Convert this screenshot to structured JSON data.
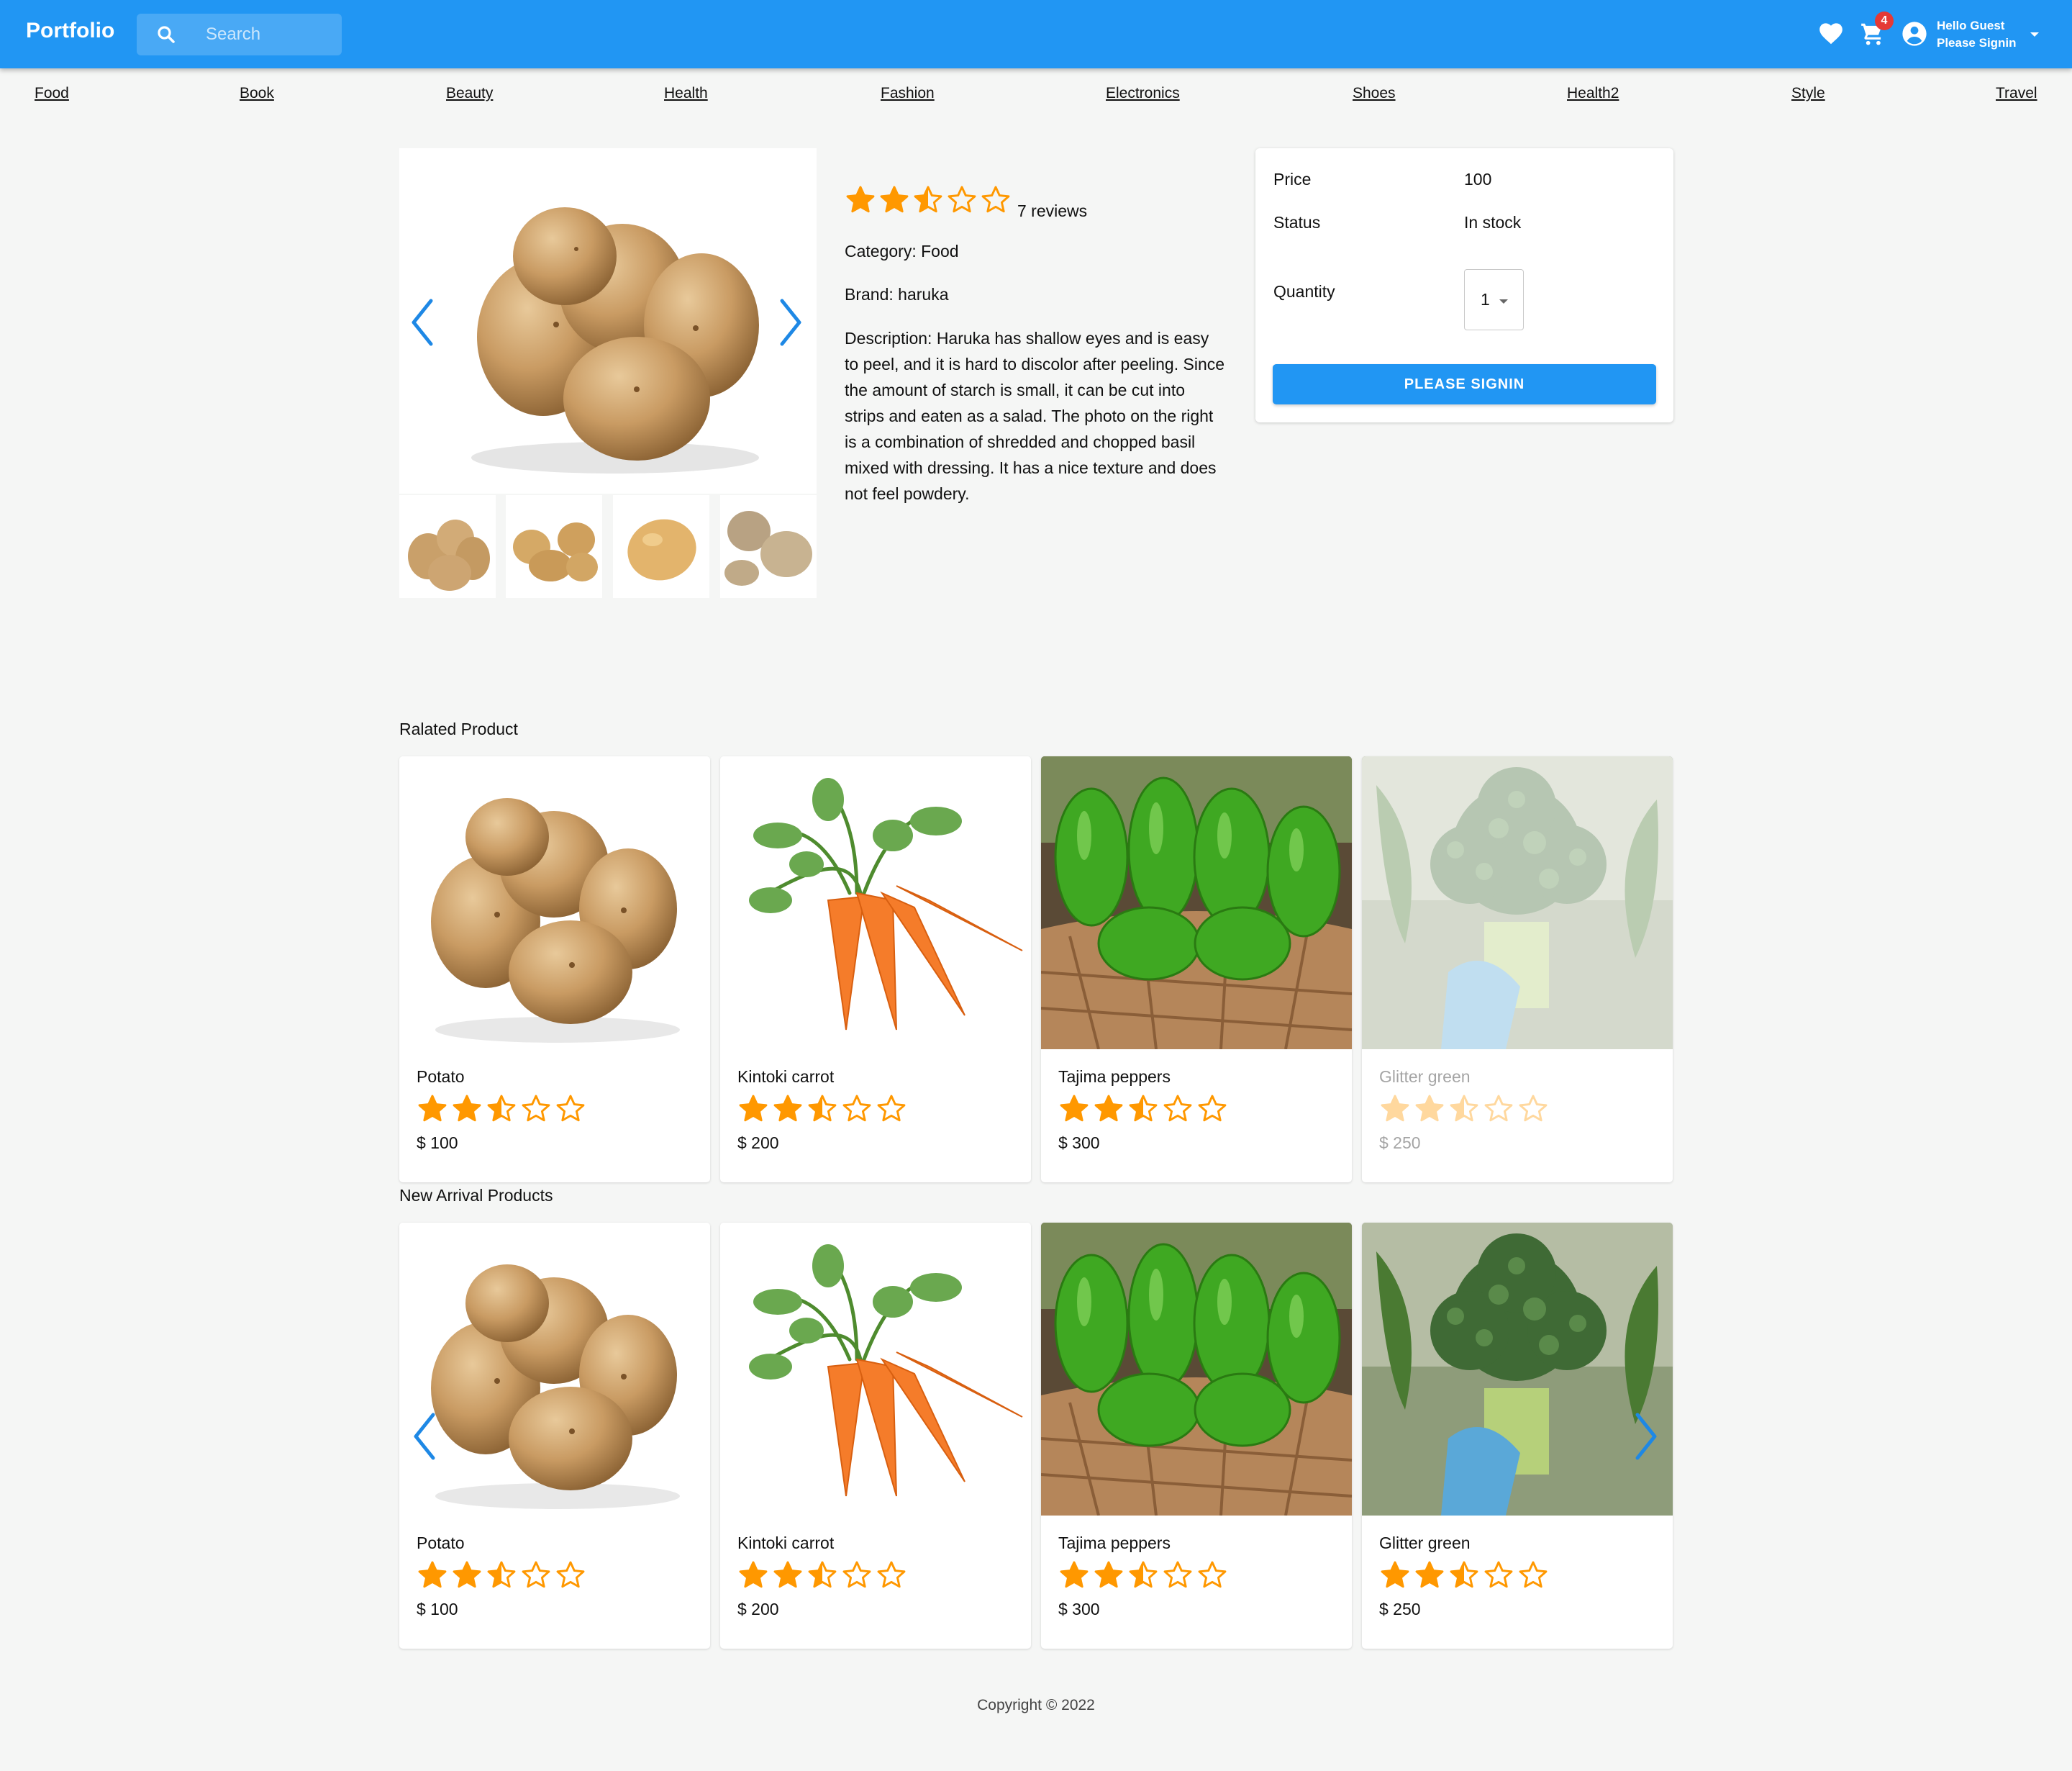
{
  "app": {
    "brand": "Portfolio",
    "search_placeholder": "Search",
    "cart_count": "4",
    "user_line1": "Hello Guest",
    "user_line2": "Please Signin",
    "accent_color": "#2196f3",
    "icons": [
      "search-icon",
      "heart-icon",
      "cart-icon",
      "account-circle-icon",
      "caret-down-icon"
    ]
  },
  "categories": [
    "Food",
    "Book",
    "Beauty",
    "Health",
    "Fashion",
    "Electronics",
    "Shoes",
    "Health2",
    "Style",
    "Travel"
  ],
  "product": {
    "rating": 2.5,
    "reviews": "7 reviews",
    "category": "Category: Food",
    "brand": "Brand: haruka",
    "description": "Description: Haruka has shallow eyes and is easy to peel, and it is hard to discolor after peeling. Since the amount of starch is small, it can be cut into strips and eaten as a salad. The photo on the right is a combination of shredded and chopped basil mixed with dressing. It has a nice texture and does not feel powdery.",
    "image_count": 4
  },
  "purchase": {
    "price_label": "Price",
    "price_value": "100",
    "status_label": "Status",
    "status_value": "In stock",
    "quantity_label": "Quantity",
    "quantity_value": "1",
    "button_label": "PLEASE SIGNIN"
  },
  "related": {
    "title": "Ralated Product",
    "items": [
      {
        "name": "Potato",
        "rating": 2.5,
        "price": "$ 100",
        "image": "potato"
      },
      {
        "name": "Kintoki carrot",
        "rating": 2.5,
        "price": "$ 200",
        "image": "carrot"
      },
      {
        "name": "Tajima peppers",
        "rating": 2.5,
        "price": "$ 300",
        "image": "peppers"
      },
      {
        "name": "Glitter green",
        "rating": 2.5,
        "price": "$ 250",
        "image": "broccoli",
        "faded": true
      }
    ]
  },
  "new_arrivals": {
    "title": "New Arrival Products",
    "items": [
      {
        "name": "Potato",
        "rating": 2.5,
        "price": "$ 100",
        "image": "potato"
      },
      {
        "name": "Kintoki carrot",
        "rating": 2.5,
        "price": "$ 200",
        "image": "carrot"
      },
      {
        "name": "Tajima peppers",
        "rating": 2.5,
        "price": "$ 300",
        "image": "peppers"
      },
      {
        "name": "Glitter green",
        "rating": 2.5,
        "price": "$ 250",
        "image": "broccoli"
      }
    ]
  },
  "footer": {
    "copyright": "Copyright © 2022"
  },
  "colors": {
    "star": "#ff9800",
    "badge": "#e53935",
    "arrow": "#1e88e5"
  }
}
